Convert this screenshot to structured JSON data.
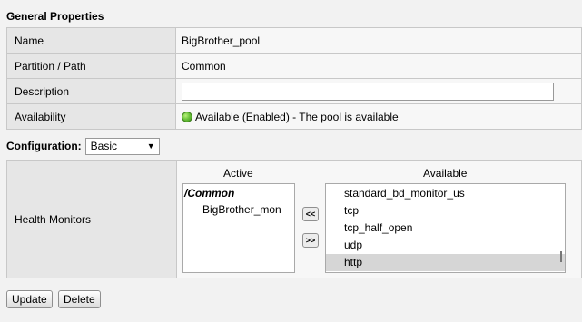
{
  "general": {
    "title": "General Properties",
    "rows": {
      "name": {
        "label": "Name",
        "value": "BigBrother_pool"
      },
      "partition": {
        "label": "Partition / Path",
        "value": "Common"
      },
      "description": {
        "label": "Description",
        "value": ""
      },
      "availability": {
        "label": "Availability",
        "value": "Available (Enabled) - The pool is available",
        "status_color": "#5cb531"
      }
    }
  },
  "configuration": {
    "label": "Configuration:",
    "selected": "Basic"
  },
  "health_monitors": {
    "label": "Health Monitors",
    "active_heading": "Active",
    "available_heading": "Available",
    "active_items": [
      "/Common",
      "BigBrother_mon"
    ],
    "available_items": [
      "standard_bd_monitor_us",
      "tcp",
      "tcp_half_open",
      "udp",
      "http"
    ],
    "move_left": "<<",
    "move_right": ">>"
  },
  "actions": {
    "update": "Update",
    "delete": "Delete"
  }
}
